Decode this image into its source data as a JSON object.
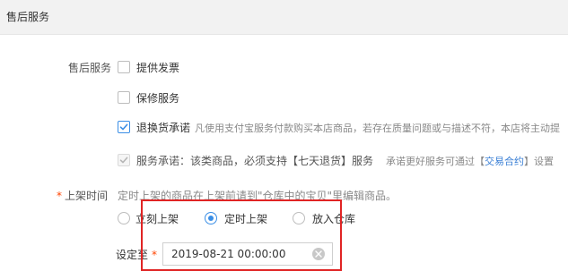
{
  "section": {
    "title": "售后服务"
  },
  "after_sales": {
    "label": "售后服务",
    "options": [
      {
        "label": "提供发票",
        "checked": false
      },
      {
        "label": "保修服务",
        "checked": false
      },
      {
        "label": "退换货承诺",
        "checked": true,
        "description": "凡使用支付宝服务付款购买本店商品，若存在质量问题或与描述不符，本店将主动提"
      }
    ],
    "service_commitment": {
      "label": "服务承诺：该类商品，必须支持【七天退货】服务",
      "checked": true,
      "disabled": true,
      "note_prefix": "承诺更好服务可通过【",
      "note_link": "交易合约",
      "note_suffix": "】设置"
    }
  },
  "listing_time": {
    "label": "上架时间",
    "required_mark": "*",
    "hint": "定时上架的商品在上架前请到\"仓库中的宝贝\"里编辑商品。",
    "radios": [
      {
        "label": "立刻上架",
        "selected": false
      },
      {
        "label": "定时上架",
        "selected": true
      },
      {
        "label": "放入仓库",
        "selected": false
      }
    ],
    "set_to": {
      "label": "设定至",
      "required_mark": "*",
      "value": "2019-08-21 00:00:00"
    }
  },
  "colors": {
    "accent": "#3a8ee6",
    "required": "#ff4400",
    "highlight": "#e02424",
    "link": "#3a7fd5"
  },
  "icons": {
    "check": "check-icon",
    "clear": "clear-icon"
  }
}
